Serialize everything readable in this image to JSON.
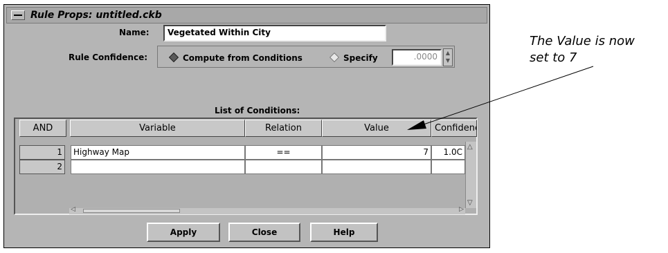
{
  "window": {
    "title": "Rule Props: untitled.ckb"
  },
  "name_field": {
    "label": "Name:",
    "value": "Vegetated Within City"
  },
  "confidence": {
    "label": "Rule Confidence:",
    "option_compute": "Compute from Conditions",
    "option_specify": "Specify",
    "specify_value": ".0000",
    "selected": "Compute from Conditions"
  },
  "conditions": {
    "title": "List of Conditions:",
    "columns": [
      "AND",
      "Variable",
      "Relation",
      "Value",
      "Confidence"
    ],
    "rows": [
      {
        "num": "1",
        "variable": "Highway Map",
        "relation": "==",
        "value": "7",
        "confidence": "1.0C"
      },
      {
        "num": "2",
        "variable": "",
        "relation": "",
        "value": "",
        "confidence": ""
      }
    ]
  },
  "buttons": {
    "apply": "Apply",
    "close": "Close",
    "help": "Help"
  },
  "annotation": {
    "line1": "The Value is now",
    "line2": "set to 7"
  },
  "colors": {
    "window_bg": "#b5b5b5",
    "selected_diamond": "#5a5a5a",
    "unselected_diamond": "#e8e8e8"
  },
  "icons": [
    "window-menu-icon",
    "radio-diamond-icon",
    "spinner-arrows-icon",
    "scroll-up-arrow-icon",
    "scroll-down-arrow-icon",
    "scroll-left-arrow-icon",
    "scroll-right-arrow-icon",
    "annotation-arrow-icon"
  ]
}
